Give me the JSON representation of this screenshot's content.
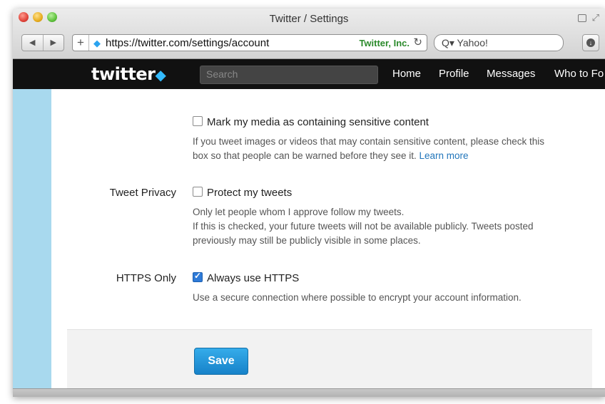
{
  "window": {
    "title": "Twitter / Settings"
  },
  "toolbar": {
    "back_label": "◀",
    "forward_label": "▶",
    "add_label": "+",
    "url": "https://twitter.com/settings/account",
    "certificate": "Twitter, Inc.",
    "reload_icon": "reload-icon",
    "search_value": "Q▾ Yahoo!",
    "download_icon": "download-icon"
  },
  "twitter_nav": {
    "logo": "twitter",
    "search_placeholder": "Search",
    "items": [
      "Home",
      "Profile",
      "Messages",
      "Who to Fo"
    ]
  },
  "settings": {
    "sensitive_media": {
      "label": "Mark my media as containing sensitive content",
      "checked": false,
      "help_line1": "If you tweet images or videos that may contain sensitive content, please check this",
      "help_line2": "box so that people can be warned before they see it.",
      "learn_more": "Learn more"
    },
    "tweet_privacy": {
      "section_label": "Tweet Privacy",
      "label": "Protect my tweets",
      "checked": false,
      "help_line1": "Only let people whom I approve follow my tweets.",
      "help_line2": "If this is checked, your future tweets will not be available publicly. Tweets posted",
      "help_line3": "previously may still be publicly visible in some places."
    },
    "https_only": {
      "section_label": "HTTPS Only",
      "label": "Always use HTTPS",
      "checked": true,
      "help": "Use a secure connection where possible to encrypt your account information."
    },
    "save_label": "Save"
  },
  "colors": {
    "accent": "#1782c9",
    "sidebar": "#a8d9ee",
    "navbar": "#111111",
    "link": "#2276bb"
  }
}
